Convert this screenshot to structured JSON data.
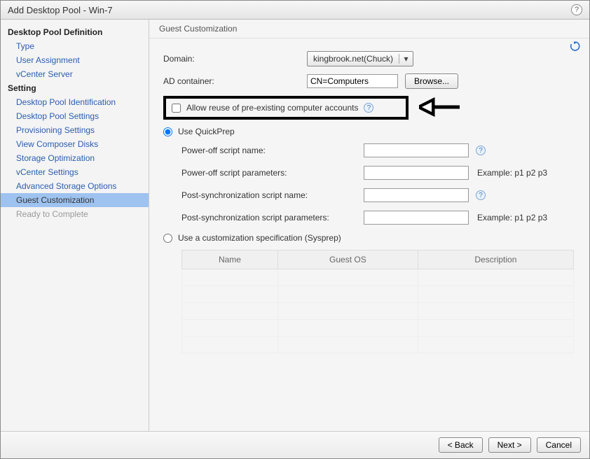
{
  "window": {
    "title": "Add Desktop Pool - Win-7"
  },
  "sidebar": {
    "heading_definition": "Desktop Pool Definition",
    "heading_setting": "Setting",
    "items_def": [
      {
        "label": "Type"
      },
      {
        "label": "User Assignment"
      },
      {
        "label": "vCenter Server"
      }
    ],
    "items_set": [
      {
        "label": "Desktop Pool Identification"
      },
      {
        "label": "Desktop Pool Settings"
      },
      {
        "label": "Provisioning Settings"
      },
      {
        "label": "View Composer Disks"
      },
      {
        "label": "Storage Optimization"
      },
      {
        "label": "vCenter Settings"
      },
      {
        "label": "Advanced Storage Options"
      },
      {
        "label": "Guest Customization"
      },
      {
        "label": "Ready to Complete"
      }
    ]
  },
  "content": {
    "header": "Guest Customization",
    "domain_label": "Domain:",
    "domain_value": "kingbrook.net(Chuck)",
    "ad_label": "AD container:",
    "ad_value": "CN=Computers",
    "browse_label": "Browse...",
    "allow_reuse_label": "Allow reuse of pre-existing computer accounts",
    "use_quickprep_label": "Use QuickPrep",
    "power_off_name_label": "Power-off script name:",
    "power_off_params_label": "Power-off script parameters:",
    "post_sync_name_label": "Post-synchronization script name:",
    "post_sync_params_label": "Post-synchronization script parameters:",
    "example_text": "Example: p1 p2 p3",
    "use_sysprep_label": "Use a customization specification (Sysprep)",
    "table_headers": {
      "name": "Name",
      "guest_os": "Guest OS",
      "description": "Description"
    }
  },
  "footer": {
    "back": "< Back",
    "next": "Next >",
    "cancel": "Cancel"
  }
}
